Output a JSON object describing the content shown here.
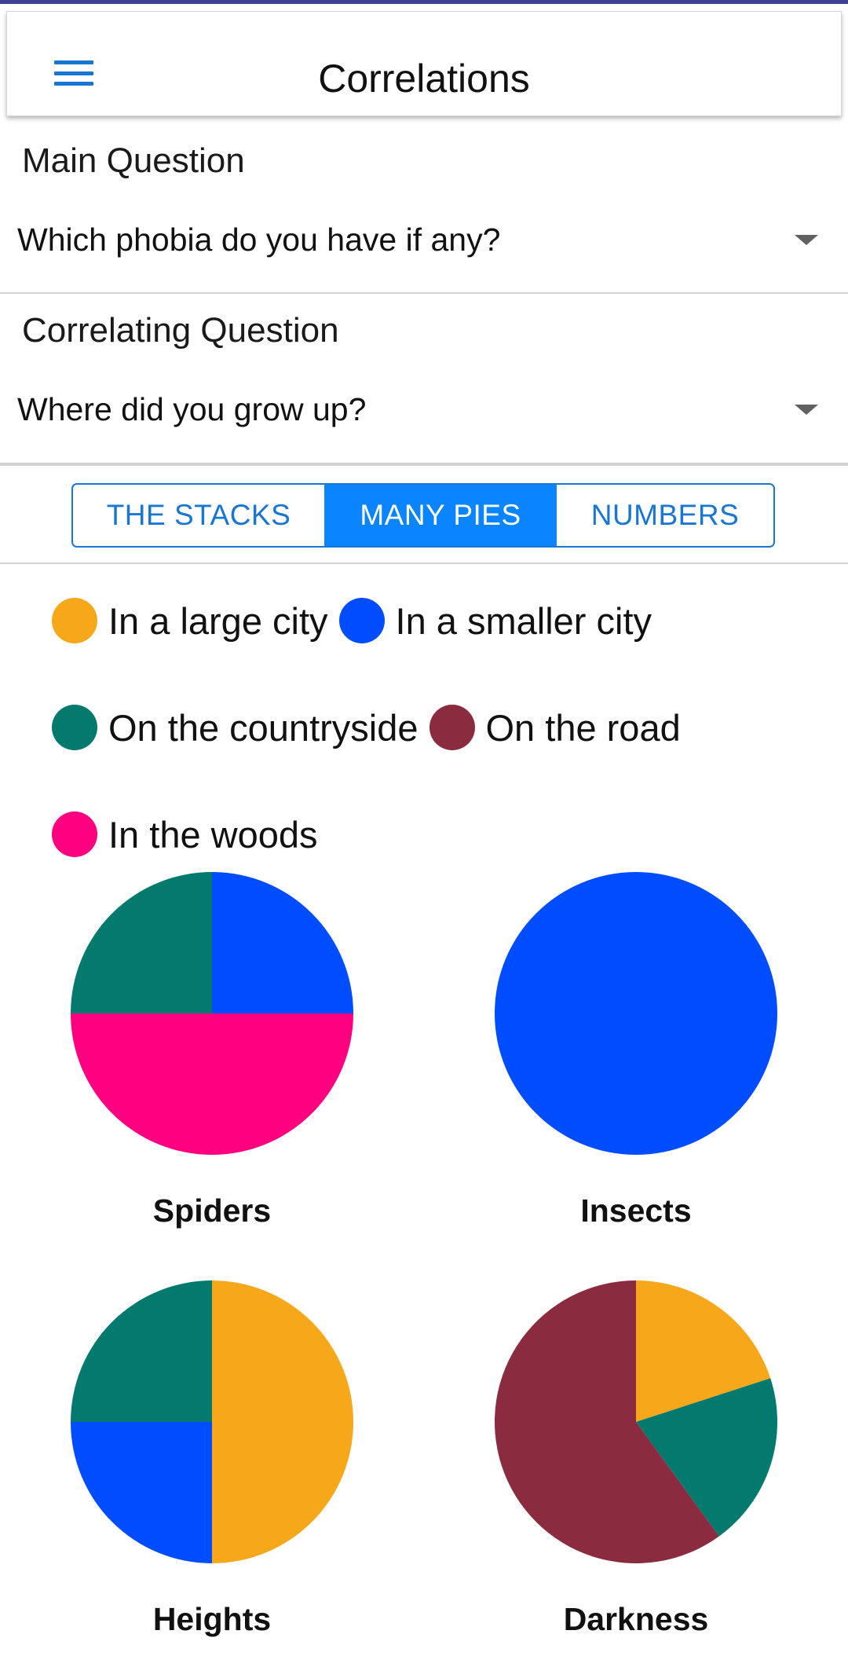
{
  "header": {
    "title": "Correlations",
    "menu_icon": "hamburger-menu-icon"
  },
  "main_question": {
    "label": "Main Question",
    "selected": "Which phobia do you have if any?"
  },
  "correlating_question": {
    "label": "Correlating Question",
    "selected": "Where did you grow up?"
  },
  "tabs": [
    {
      "label": "THE STACKS",
      "active": false
    },
    {
      "label": "MANY PIES",
      "active": true
    },
    {
      "label": "NUMBERS",
      "active": false
    }
  ],
  "colors": {
    "accent": "#1976d2",
    "active_tab": "#0a84ff"
  },
  "legend": [
    {
      "label": "In a large city",
      "color": "#f6a81a"
    },
    {
      "label": "In a smaller city",
      "color": "#004dff"
    },
    {
      "label": "On the countryside",
      "color": "#047a6e"
    },
    {
      "label": "On the road",
      "color": "#8b2b3f"
    },
    {
      "label": "In the woods",
      "color": "#ff0080"
    }
  ],
  "chart_data": [
    {
      "type": "pie",
      "title": "Spiders",
      "slices": [
        {
          "category": "In a smaller city",
          "value": 25
        },
        {
          "category": "In the woods",
          "value": 50
        },
        {
          "category": "On the countryside",
          "value": 25
        }
      ]
    },
    {
      "type": "pie",
      "title": "Insects",
      "slices": [
        {
          "category": "In a smaller city",
          "value": 100
        }
      ]
    },
    {
      "type": "pie",
      "title": "Heights",
      "slices": [
        {
          "category": "In a large city",
          "value": 50
        },
        {
          "category": "In a smaller city",
          "value": 25
        },
        {
          "category": "On the countryside",
          "value": 25
        }
      ]
    },
    {
      "type": "pie",
      "title": "Darkness",
      "slices": [
        {
          "category": "In a large city",
          "value": 20
        },
        {
          "category": "On the countryside",
          "value": 20
        },
        {
          "category": "On the road",
          "value": 60
        }
      ]
    }
  ]
}
